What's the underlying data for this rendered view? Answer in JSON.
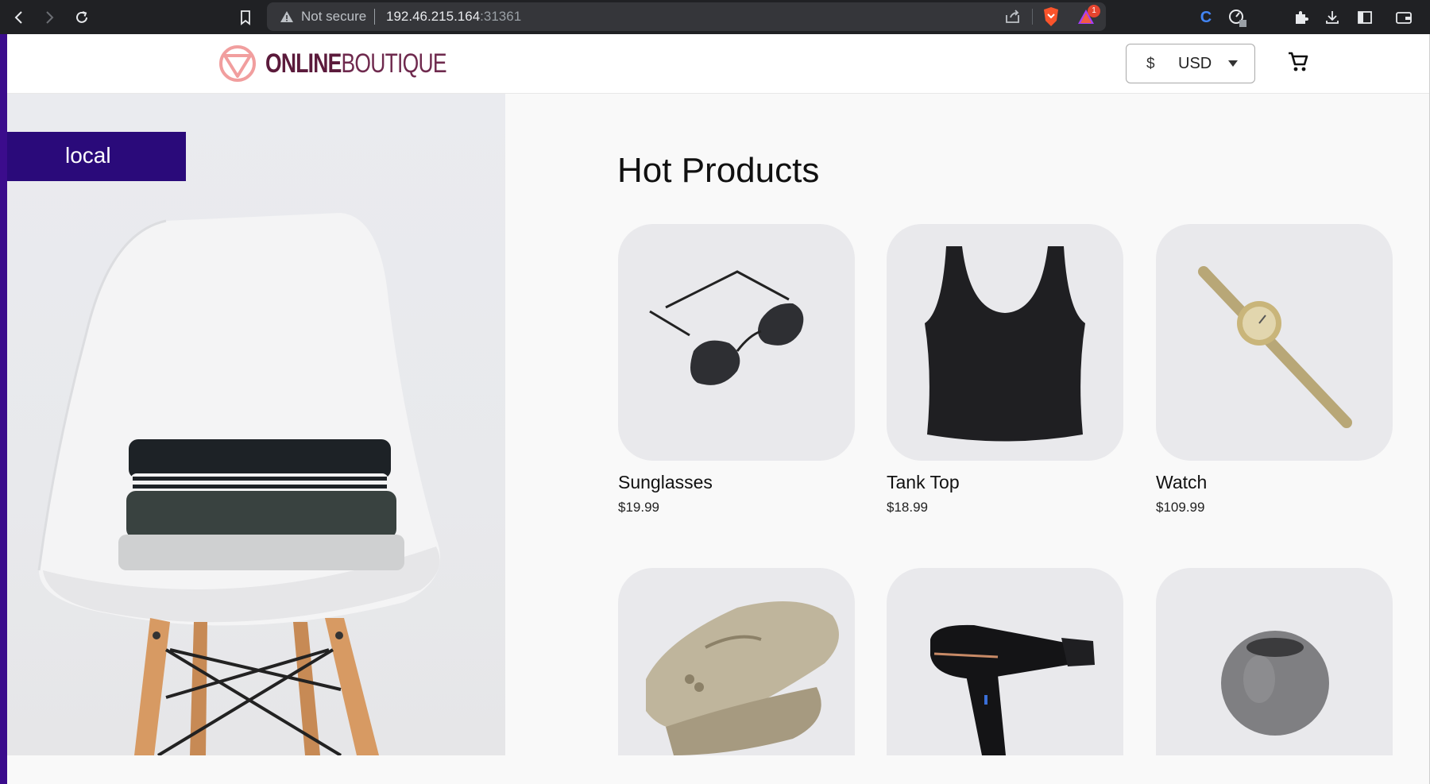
{
  "browser": {
    "security_label": "Not secure",
    "url_host": "192.46.215.164",
    "url_port": ":31361",
    "notification_count": "1"
  },
  "header": {
    "logo_bold": "ONLINE",
    "logo_light": "BOUTIQUE",
    "currency_symbol": "$",
    "currency_code": "USD"
  },
  "hero": {
    "environment_label": "local"
  },
  "main": {
    "title": "Hot Products",
    "products": [
      {
        "name": "Sunglasses",
        "price": "$19.99"
      },
      {
        "name": "Tank Top",
        "price": "$18.99"
      },
      {
        "name": "Watch",
        "price": "$109.99"
      },
      {
        "name": "",
        "price": ""
      },
      {
        "name": "",
        "price": ""
      },
      {
        "name": "",
        "price": ""
      }
    ]
  },
  "colors": {
    "accent": "#3b0c8c",
    "env_badge": "#2a0a7a",
    "brand": "#5b1a3b",
    "logo_icon": "#f19e9e"
  }
}
